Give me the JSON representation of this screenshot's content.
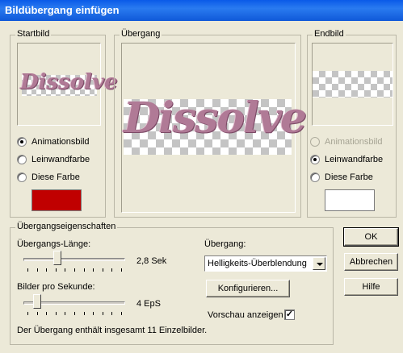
{
  "window": {
    "title": "Bildübergang einfügen"
  },
  "colors": {
    "title_bar": "#0a5ae8",
    "start_color": "#c00000",
    "end_color": "#ffffff"
  },
  "start_group": {
    "legend": "Startbild",
    "preview_text": "Dissolve",
    "options": [
      {
        "label": "Animationsbild",
        "selected": true,
        "enabled": true
      },
      {
        "label": "Leinwandfarbe",
        "selected": false,
        "enabled": true
      },
      {
        "label": "Diese Farbe",
        "selected": false,
        "enabled": true
      }
    ]
  },
  "transition_group": {
    "legend": "Übergang",
    "preview_text": "Dissolve"
  },
  "end_group": {
    "legend": "Endbild",
    "options": [
      {
        "label": "Animationsbild",
        "selected": false,
        "enabled": false
      },
      {
        "label": "Leinwandfarbe",
        "selected": true,
        "enabled": true
      },
      {
        "label": "Diese Farbe",
        "selected": false,
        "enabled": true
      }
    ]
  },
  "properties": {
    "legend": "Übergangseigenschaften",
    "length_label": "Übergangs-Länge:",
    "length_value": "2,8 Sek",
    "length_fraction": 0.32,
    "fps_label": "Bilder pro Sekunde:",
    "fps_value": "4 EpS",
    "fps_fraction": 0.1,
    "transition_label": "Übergang:",
    "transition_selected": "Helligkeits-Überblendung",
    "configure_label": "Konfigurieren...",
    "preview_label": "Vorschau anzeigen",
    "preview_checked": true,
    "info_text": "Der Übergang enthält insgesamt 11 Einzelbilder."
  },
  "buttons": {
    "ok": "OK",
    "cancel": "Abbrechen",
    "help": "Hilfe"
  }
}
